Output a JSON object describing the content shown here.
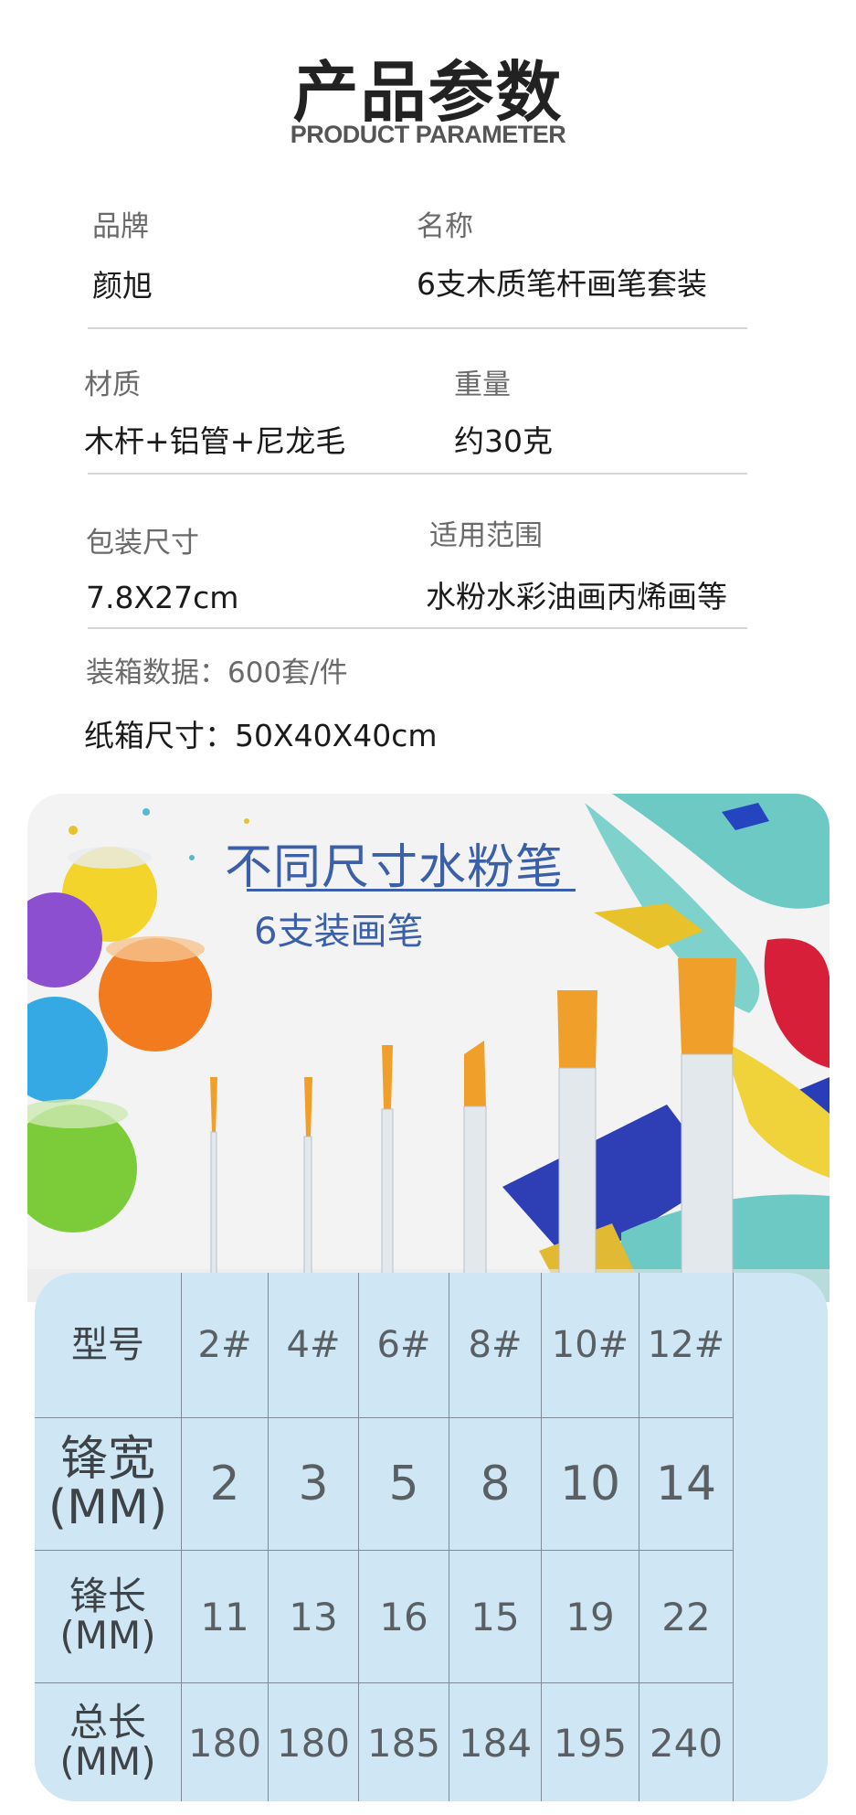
{
  "header": {
    "title": "产品参数",
    "subtitle": "PRODUCT PARAMETER"
  },
  "params": {
    "brand_label": "品牌",
    "brand_value": "颜旭",
    "name_label": "名称",
    "name_value": "6支木质笔杆画笔套装",
    "material_label": "材质",
    "material_value": "木杆+铝管+尼龙毛",
    "weight_label": "重量",
    "weight_value": "约30克",
    "package_label": "包装尺寸",
    "package_value": "7.8X27cm",
    "scope_label": "适用范围",
    "scope_value": "水粉水彩油画丙烯画等",
    "carton_qty": "装箱数据：600套/件",
    "carton_size": "纸箱尺寸：50X40X40cm"
  },
  "banner": {
    "title": "不同尺寸水粉笔",
    "subtitle": "6支装画笔"
  },
  "spec_table": {
    "row_headers": [
      [
        "型号"
      ],
      [
        "锋宽",
        "(MM)"
      ],
      [
        "锋长",
        "(MM)"
      ],
      [
        "总长",
        "(MM)"
      ]
    ],
    "models": [
      "2#",
      "4#",
      "6#",
      "8#",
      "10#",
      "12#"
    ],
    "tip_width": [
      "2",
      "3",
      "5",
      "8",
      "10",
      "14"
    ],
    "tip_length": [
      "11",
      "13",
      "16",
      "15",
      "19",
      "22"
    ],
    "total_length": [
      "180",
      "180",
      "185",
      "184",
      "195",
      "240"
    ]
  },
  "colors": {
    "accent_blue": "#3b5fa8",
    "table_bg": "#cfe7f5",
    "brush_tip": "#f0a02a"
  }
}
